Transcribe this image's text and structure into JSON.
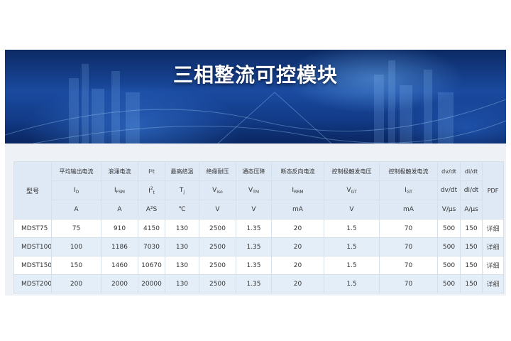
{
  "banner": {
    "title": "三相整流可控模块"
  },
  "table": {
    "model_header": "型号",
    "pdf_header": "PDF",
    "columns": [
      {
        "name": "平均输出电流",
        "sym": "I",
        "sub": "O",
        "sup": "",
        "unit": "A"
      },
      {
        "name": "浪涌电流",
        "sym": "I",
        "sub": "FSM",
        "sup": "",
        "unit": "A"
      },
      {
        "name": "I²t",
        "sym": "I",
        "sub": "t",
        "sup": "2",
        "unit": "A²S"
      },
      {
        "name": "最高结温",
        "sym": "T",
        "sub": "j",
        "sup": "",
        "unit": "℃"
      },
      {
        "name": "绝缘耐压",
        "sym": "V",
        "sub": "iso",
        "sup": "",
        "unit": "V"
      },
      {
        "name": "通态压降",
        "sym": "V",
        "sub": "TM",
        "sup": "",
        "unit": "V"
      },
      {
        "name": "断态反向电流",
        "sym": "I",
        "sub": "RRM",
        "sup": "",
        "unit": "mA"
      },
      {
        "name": "控制极触发电压",
        "sym": "V",
        "sub": "GT",
        "sup": "",
        "unit": "V"
      },
      {
        "name": "控制极触发电流",
        "sym": "I",
        "sub": "GT",
        "sup": "",
        "unit": "mA"
      },
      {
        "name": "dv/dt",
        "sym": "dv/dt",
        "sub": "",
        "sup": "",
        "unit": "V/μs"
      },
      {
        "name": "di/dt",
        "sym": "di/dt",
        "sub": "",
        "sup": "",
        "unit": "A/μs"
      }
    ],
    "rows": [
      {
        "model": "MDST75",
        "values": [
          "75",
          "910",
          "4150",
          "130",
          "2500",
          "1.35",
          "20",
          "1.5",
          "70",
          "500",
          "150"
        ],
        "link": "详细"
      },
      {
        "model": "MDST100",
        "values": [
          "100",
          "1186",
          "7030",
          "130",
          "2500",
          "1.35",
          "20",
          "1.5",
          "70",
          "500",
          "150"
        ],
        "link": "详细"
      },
      {
        "model": "MDST150",
        "values": [
          "150",
          "1460",
          "10670",
          "130",
          "2500",
          "1.35",
          "20",
          "1.5",
          "70",
          "500",
          "150"
        ],
        "link": "详细"
      },
      {
        "model": "MDST200",
        "values": [
          "200",
          "2000",
          "20000",
          "130",
          "2500",
          "1.35",
          "20",
          "1.5",
          "70",
          "500",
          "150"
        ],
        "link": "详细"
      }
    ]
  }
}
